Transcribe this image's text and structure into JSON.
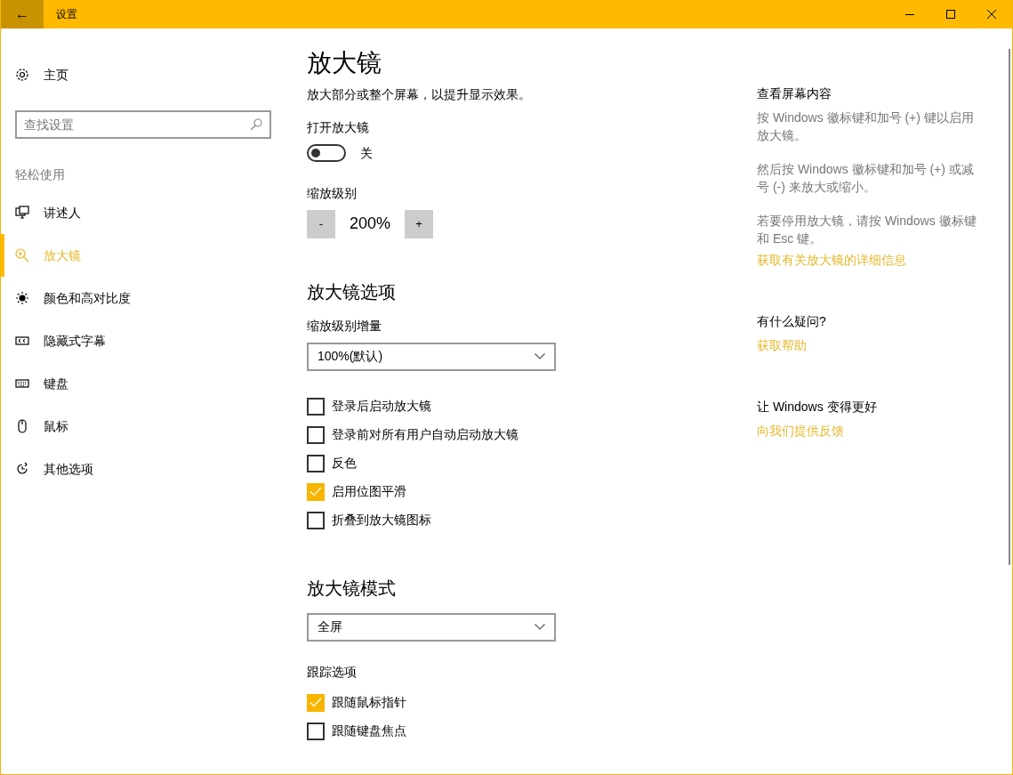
{
  "window": {
    "title": "设置",
    "back": "←"
  },
  "sidebar": {
    "home": "主页",
    "search": {
      "placeholder": "查找设置"
    },
    "section_label": "轻松使用",
    "items": [
      {
        "label": "讲述人",
        "selected": false
      },
      {
        "label": "放大镜",
        "selected": true
      },
      {
        "label": "颜色和高对比度",
        "selected": false
      },
      {
        "label": "隐藏式字幕",
        "selected": false
      },
      {
        "label": "键盘",
        "selected": false
      },
      {
        "label": "鼠标",
        "selected": false
      },
      {
        "label": "其他选项",
        "selected": false
      }
    ]
  },
  "main": {
    "title": "放大镜",
    "description": "放大部分或整个屏幕，以提升显示效果。",
    "toggle": {
      "label": "打开放大镜",
      "on": false,
      "state_text": "关"
    },
    "zoom": {
      "label": "缩放级别",
      "minus": "-",
      "value": "200%",
      "plus": "+"
    },
    "options_heading": "放大镜选项",
    "increment": {
      "label": "缩放级别增量",
      "value": "100%(默认)"
    },
    "options": [
      {
        "label": "登录后启动放大镜",
        "checked": false
      },
      {
        "label": "登录前对所有用户自动启动放大镜",
        "checked": false
      },
      {
        "label": "反色",
        "checked": false
      },
      {
        "label": "启用位图平滑",
        "checked": true
      },
      {
        "label": "折叠到放大镜图标",
        "checked": false
      }
    ],
    "mode_heading": "放大镜模式",
    "mode": {
      "value": "全屏"
    },
    "tracking": {
      "label": "跟踪选项",
      "options": [
        {
          "label": "跟随鼠标指针",
          "checked": true
        },
        {
          "label": "跟随键盘焦点",
          "checked": false
        }
      ]
    }
  },
  "aside": [
    {
      "heading": "查看屏幕内容",
      "paragraphs": [
        "按 Windows 徽标键和加号 (+) 键以启用放大镜。",
        "然后按 Windows 徽标键和加号 (+) 或减号 (-) 来放大或缩小。",
        "若要停用放大镜，请按 Windows 徽标键和 Esc 键。"
      ],
      "link": "获取有关放大镜的详细信息"
    },
    {
      "heading": "有什么疑问?",
      "link": "获取帮助"
    },
    {
      "heading": "让 Windows 变得更好",
      "link": "向我们提供反馈"
    }
  ]
}
